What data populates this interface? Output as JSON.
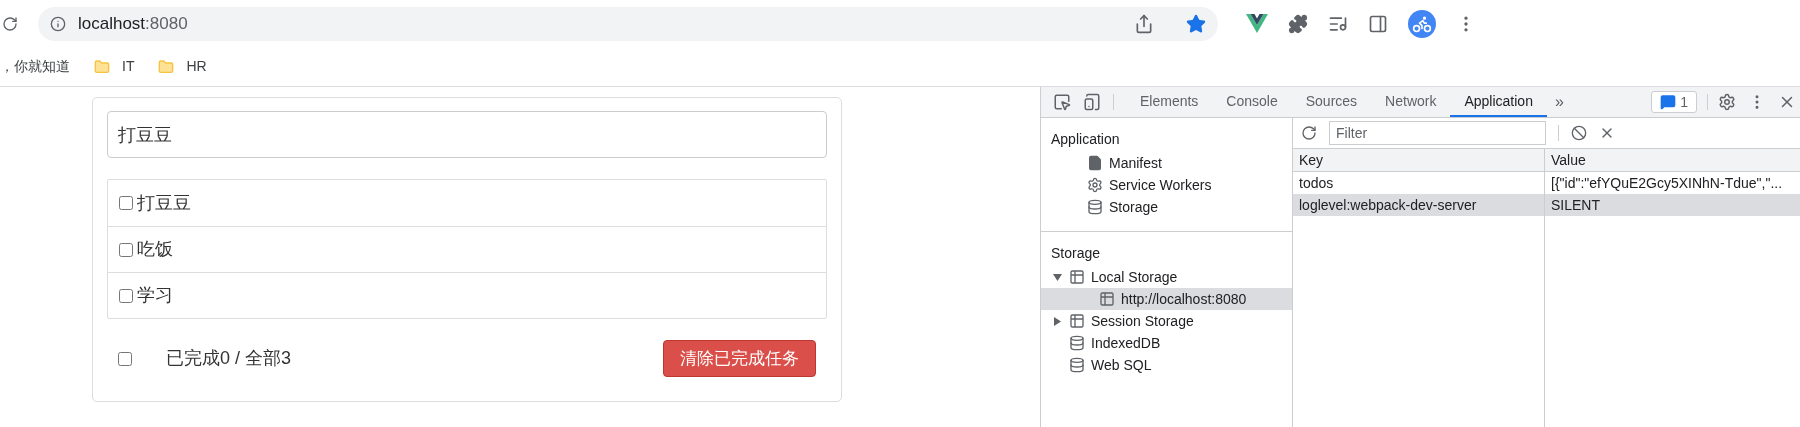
{
  "browser": {
    "address": {
      "host": "localhost",
      "port": ":8080"
    },
    "bookmarks": [
      {
        "kind": "text",
        "label": "，你就知道"
      },
      {
        "kind": "folder",
        "label": "IT"
      },
      {
        "kind": "folder",
        "label": "HR"
      }
    ]
  },
  "todo": {
    "input_value": "打豆豆",
    "items": [
      {
        "label": "打豆豆",
        "checked": false
      },
      {
        "label": "吃饭",
        "checked": false
      },
      {
        "label": "学习",
        "checked": false
      }
    ],
    "footer": {
      "all_checked": false,
      "summary": "已完成0 / 全部3",
      "clear_button": "清除已完成任务"
    }
  },
  "devtools": {
    "tabs": [
      {
        "label": "Elements",
        "selected": false
      },
      {
        "label": "Console",
        "selected": false
      },
      {
        "label": "Sources",
        "selected": false
      },
      {
        "label": "Network",
        "selected": false
      },
      {
        "label": "Application",
        "selected": true
      }
    ],
    "more": "»",
    "issues_count": "1",
    "sidebar": [
      {
        "title": "Application",
        "items": [
          {
            "kind": "file",
            "label": "Manifest",
            "selected": false
          },
          {
            "kind": "gear",
            "label": "Service Workers",
            "selected": false
          },
          {
            "kind": "database",
            "label": "Storage",
            "selected": false
          }
        ]
      },
      {
        "title": "Storage",
        "items": [
          {
            "kind": "grid",
            "label": "Local Storage",
            "expanded": true,
            "selected": false,
            "children": [
              {
                "kind": "grid",
                "label": "http://localhost:8080",
                "selected": true
              }
            ]
          },
          {
            "kind": "grid",
            "label": "Session Storage",
            "expanded": false,
            "selected": false
          },
          {
            "kind": "database",
            "label": "IndexedDB",
            "selected": false
          },
          {
            "kind": "database",
            "label": "Web SQL",
            "selected": false
          }
        ]
      }
    ],
    "filter": {
      "placeholder": "Filter"
    },
    "columns": [
      "Key",
      "Value"
    ],
    "rows": [
      {
        "key": "todos",
        "value": "[{\"id\":\"efYQuE2Gcy5XINhN-Tdue\",\"...",
        "selected": false
      },
      {
        "key": "loglevel:webpack-dev-server",
        "value": "SILENT",
        "selected": true
      }
    ]
  }
}
